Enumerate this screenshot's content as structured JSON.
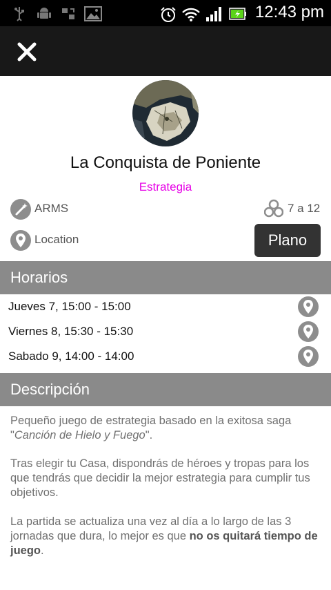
{
  "status_bar": {
    "time": "12:43 pm",
    "icons": [
      "usb-icon",
      "android-icon",
      "sync-icon",
      "gallery-icon",
      "alarm-icon",
      "wifi-icon",
      "signal-icon",
      "battery-icon"
    ]
  },
  "app_bar": {
    "close_icon": "close-icon"
  },
  "event": {
    "title": "La Conquista de Poniente",
    "category": "Estrategia",
    "organizer": "ARMS",
    "players": "7 a 12",
    "location": "Location",
    "plano_label": "Plano"
  },
  "schedule": {
    "header": "Horarios",
    "items": [
      "Jueves 7, 15:00 - 15:00",
      "Viernes 8, 15:30 - 15:30",
      "Sabado 9, 14:00 - 14:00"
    ]
  },
  "description": {
    "header": "Descripción",
    "p1_a": "Pequeño juego de estrategia basado en la exitosa saga \"",
    "p1_italic": "Canción de Hielo y Fuego",
    "p1_b": "\".",
    "p2": "Tras elegir tu Casa, dispondrás de héroes y tropas para los que tendrás que decidir la mejor estrategia para cumplir tus objetivos.",
    "p3_a": "La partida se actualiza una vez al día a lo largo de las 3 jornadas que dura, lo mejor es que ",
    "p3_bold": "no os quitará tiempo de juego",
    "p3_b": "."
  },
  "colors": {
    "accent_category": "#e600e6",
    "section_header_bg": "#8a8a8a",
    "button_bg": "#333333",
    "icon_gray": "#8d8d8d"
  }
}
